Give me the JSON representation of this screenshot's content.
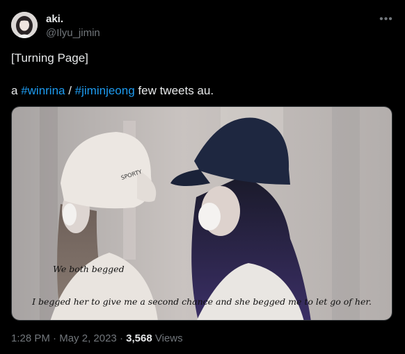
{
  "author": {
    "display_name": "aki.",
    "handle": "@Ilyu_jimin",
    "avatar_icon": "profile-photo"
  },
  "menu": {
    "more_icon": "more-horizontal-icon"
  },
  "tweet": {
    "title_line": "[Turning Page]",
    "desc_prefix": "a ",
    "hashtag_1": "#winrina",
    "separator": " / ",
    "hashtag_2": "#jiminjeong",
    "desc_suffix": " few tweets au."
  },
  "media": {
    "caption_line1": "We both begged",
    "caption_line2": "I begged her to give me a second chance and she begged me to let go of her."
  },
  "footer": {
    "time": "1:28 PM",
    "dot1": " · ",
    "date": "May 2, 2023",
    "dot2": " · ",
    "views_count": "3,568",
    "views_label": " Views"
  },
  "colors": {
    "background": "#000000",
    "text": "#e7e9ea",
    "muted": "#71767b",
    "link": "#1d9bf0"
  }
}
